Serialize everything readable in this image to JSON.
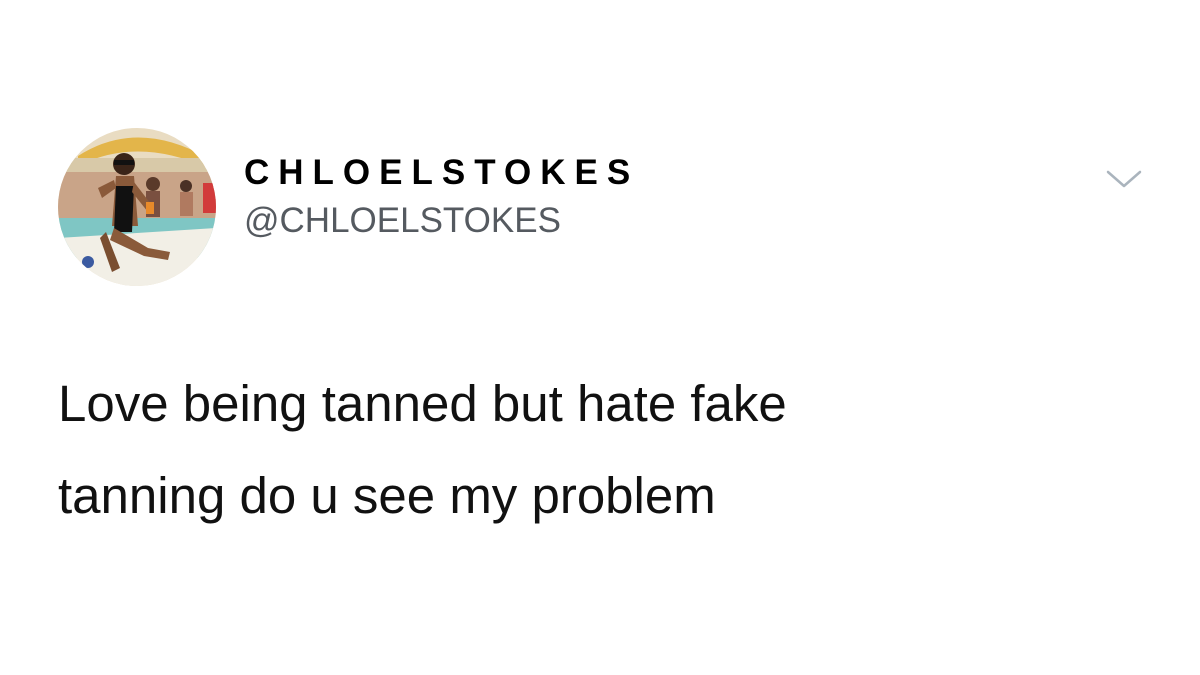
{
  "tweet": {
    "display_name": "CHLOELSTOKES",
    "handle": "@CHLOELSTOKES",
    "text_line_1": "Love being tanned but hate fake",
    "text_line_2": "tanning do u see my problem"
  },
  "icons": {
    "menu": "chevron-down-icon",
    "avatar": "profile-photo"
  },
  "colors": {
    "background": "#ffffff",
    "text": "#111111",
    "handle": "#555a60",
    "chevron": "#aab4bd"
  }
}
